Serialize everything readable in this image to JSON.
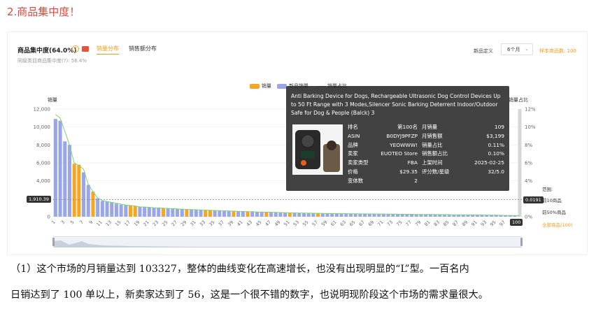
{
  "section_title": "2.商品集中度！",
  "header": {
    "title": "商品集中度(64.0%)",
    "tabs": [
      "销量分布",
      "销售额分布"
    ],
    "active_tab": 0,
    "subtitle": "同级类目商品集中度(?): 56.4%"
  },
  "controls": {
    "define_label": "新品定义",
    "period_value": "6个月",
    "sample_label": "样本商品数: 100"
  },
  "legend": [
    {
      "label": "销量",
      "color": "#f5a623"
    },
    {
      "label": "新品销量",
      "color": "#9aa6e8"
    },
    {
      "label": "销量占比",
      "color": "#7ed36b"
    }
  ],
  "axis": {
    "left_title": "销量",
    "right_title": "销量占比",
    "left_ticks": [
      "12,000",
      "10,000",
      "8,000",
      "6,000",
      "4,000",
      "2,000",
      "0"
    ],
    "right_ticks": [
      "12%",
      "10%",
      "8%",
      "6%",
      "4%",
      "2%",
      "0%"
    ],
    "x_ticks": [
      "1",
      "3",
      "5",
      "7",
      "9",
      "11",
      "13",
      "15",
      "17",
      "19",
      "21",
      "23",
      "25",
      "27",
      "29",
      "31",
      "33",
      "35",
      "37",
      "39",
      "41",
      "43",
      "45",
      "47",
      "49",
      "51",
      "53",
      "55",
      "57",
      "59",
      "61",
      "63",
      "65",
      "67",
      "69",
      "71",
      "73",
      "75",
      "77",
      "79",
      "81",
      "83",
      "85",
      "87",
      "89",
      "91",
      "93",
      "95",
      "97"
    ]
  },
  "markers": {
    "left_value": "1,910.39",
    "right_value": "0.0191",
    "hover_x": "100"
  },
  "range_legend": {
    "title": "范围:",
    "top10": "前10商品",
    "top50": "前50%商品",
    "all": "全部商品(100)"
  },
  "tooltip": {
    "title": "Anti Barking Device for Dogs, Rechargeable Ultrasonic Dog Control Devices Up to 50 Ft Range with 3 Modes,Silencer Sonic Barking Deterrent Indoor/Outdoor Safe for Dog & People (Balck) 3",
    "rows": [
      {
        "k1": "排名",
        "v1": "第100名",
        "k2": "月销量",
        "v2": "109"
      },
      {
        "k1": "ASIN",
        "v1": "B0DYJ9PFZP",
        "k2": "月销售额",
        "v2": "$3,199"
      },
      {
        "k1": "品牌",
        "v1": "YEOWWW!",
        "k2": "销量占比",
        "v2": "0.11%"
      },
      {
        "k1": "卖家",
        "v1": "EUOTEO Store",
        "k2": "销售额占比",
        "v2": "0.10%"
      },
      {
        "k1": "卖家类型",
        "v1": "FBA",
        "k2": "上架时间",
        "v2": "2025-02-25"
      },
      {
        "k1": "价格",
        "v1": "$29.35",
        "k2": "评分数/星级",
        "v2": "32/5.0"
      },
      {
        "k1": "变体数",
        "v1": "2",
        "k2": "",
        "v2": ""
      }
    ]
  },
  "chart_data": {
    "type": "bar",
    "title": "",
    "xlabel": "",
    "ylabel": "销量",
    "y2label": "销量占比",
    "ylim": [
      0,
      12000
    ],
    "y2lim": [
      0,
      12
    ],
    "x": [
      1,
      2,
      3,
      4,
      5,
      6,
      7,
      8,
      9,
      10,
      11,
      12,
      13,
      14,
      15,
      16,
      17,
      18,
      19,
      20,
      21,
      22,
      23,
      24,
      25,
      26,
      27,
      28,
      29,
      30,
      31,
      32,
      33,
      34,
      35,
      36,
      37,
      38,
      39,
      40,
      41,
      42,
      43,
      44,
      45,
      46,
      47,
      48,
      49,
      50,
      51,
      52,
      53,
      54,
      55,
      56,
      57,
      58,
      59,
      60,
      61,
      62,
      63,
      64,
      65,
      66,
      67,
      68,
      69,
      70,
      71,
      72,
      73,
      74,
      75,
      76,
      77,
      78,
      79,
      80,
      81,
      82,
      83,
      84,
      85,
      86,
      87,
      88,
      89,
      90,
      91,
      92,
      93,
      94,
      95,
      96,
      97,
      98,
      99,
      100
    ],
    "series": [
      {
        "name": "销量",
        "values": [
          10900,
          10700,
          8400,
          8000,
          5900,
          5800,
          4950,
          3550,
          2800,
          2050,
          1750,
          1700,
          1600,
          1450,
          1350,
          1300,
          1250,
          1200,
          1100,
          1080,
          1050,
          1000,
          980,
          950,
          930,
          900,
          870,
          850,
          820,
          800,
          780,
          760,
          740,
          720,
          700,
          680,
          660,
          640,
          620,
          600,
          585,
          570,
          555,
          540,
          525,
          510,
          495,
          480,
          465,
          450,
          440,
          430,
          420,
          410,
          400,
          390,
          380,
          370,
          360,
          350,
          345,
          340,
          335,
          330,
          325,
          320,
          315,
          310,
          305,
          300,
          295,
          290,
          285,
          280,
          275,
          270,
          265,
          260,
          255,
          250,
          245,
          240,
          235,
          230,
          225,
          220,
          215,
          210,
          205,
          200,
          195,
          190,
          185,
          180,
          170,
          160,
          150,
          140,
          125,
          109
        ]
      },
      {
        "name": "新品",
        "values": [
          1,
          1,
          1,
          1,
          0,
          0,
          1,
          1,
          0,
          1,
          1,
          1,
          1,
          1,
          1,
          1,
          0,
          0,
          1,
          1,
          1,
          1,
          1,
          0,
          1,
          1,
          1,
          1,
          0,
          1,
          1,
          1,
          0,
          0,
          1,
          1,
          1,
          1,
          0,
          1,
          1,
          0,
          1,
          1,
          1,
          0,
          1,
          1,
          1,
          1,
          0,
          1,
          1,
          1,
          1,
          1,
          0,
          1,
          1,
          1,
          1,
          1,
          1,
          1,
          1,
          1,
          1,
          1,
          1,
          1,
          1,
          1,
          1,
          1,
          1,
          1,
          1,
          1,
          1,
          1,
          1,
          1,
          1,
          1,
          1,
          1,
          1,
          1,
          1,
          1,
          1,
          1,
          1,
          1,
          1,
          1,
          1,
          1,
          1,
          1
        ]
      },
      {
        "name": "销量占比",
        "values": [
          11.4,
          11.0,
          9.5,
          8.0,
          6.0,
          5.7,
          5.3,
          3.6,
          2.8,
          2.1,
          1.8,
          1.7,
          1.6,
          1.5,
          1.4,
          1.3,
          1.25,
          1.2,
          1.1,
          1.08,
          1.05,
          1.0,
          0.98,
          0.95,
          0.93,
          0.9,
          0.87,
          0.85,
          0.82,
          0.8,
          0.78,
          0.76,
          0.74,
          0.72,
          0.7,
          0.68,
          0.66,
          0.64,
          0.62,
          0.6,
          0.59,
          0.57,
          0.56,
          0.54,
          0.53,
          0.51,
          0.5,
          0.48,
          0.47,
          0.45,
          0.44,
          0.43,
          0.42,
          0.41,
          0.4,
          0.39,
          0.38,
          0.37,
          0.36,
          0.35,
          0.35,
          0.34,
          0.34,
          0.33,
          0.33,
          0.32,
          0.32,
          0.31,
          0.31,
          0.3,
          0.3,
          0.29,
          0.29,
          0.28,
          0.28,
          0.27,
          0.27,
          0.26,
          0.26,
          0.25,
          0.25,
          0.24,
          0.24,
          0.23,
          0.23,
          0.22,
          0.22,
          0.21,
          0.21,
          0.2,
          0.2,
          0.19,
          0.19,
          0.18,
          0.17,
          0.16,
          0.15,
          0.14,
          0.13,
          0.11
        ]
      }
    ],
    "reference_line": 1910.39,
    "grid": true,
    "legend": "top"
  },
  "paragraph": [
    "（1）这个市场的月销量达到 103327，整体的曲线变化在高速增长，也没有出现明显的“L”型。一百名内",
    "日销达到了 100 单以上，新卖家达到了 56，这是一个很不错的数字，也说明现阶段这个市场的需求量很大。"
  ]
}
